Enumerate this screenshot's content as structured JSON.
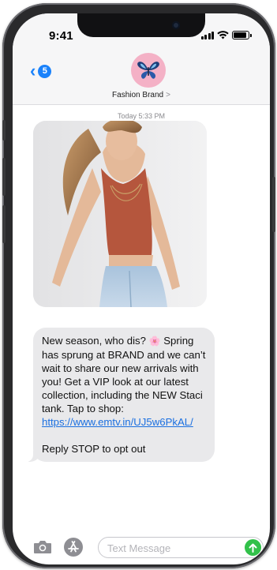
{
  "status_bar": {
    "time": "9:41",
    "battery_level": 0.9
  },
  "header": {
    "back_count": "5",
    "contact_name": "Fashion Brand",
    "contact_chevron": ">",
    "avatar_icon": "butterfly-icon"
  },
  "conversation": {
    "timestamp": "Today 5:33 PM",
    "image_icon": "photo-model-icon",
    "message": {
      "line1_prefix": "New season, who dis? ",
      "line1_emoji": "🌸",
      "line1_suffix": " Spring has sprung at BRAND and we can’t wait to share our new arrivals with you! Get a VIP look at our latest collection, including the NEW Staci tank. Tap to shop: ",
      "link": "https://www.emtv.in/UJ5w6PkAL/",
      "optout": "Reply STOP to opt out"
    }
  },
  "composer": {
    "placeholder": "Text Message"
  },
  "colors": {
    "accent": "#1a82fb",
    "bubble": "#e9e9eb",
    "send": "#32c14a",
    "avatar": "#f4b1c6"
  }
}
